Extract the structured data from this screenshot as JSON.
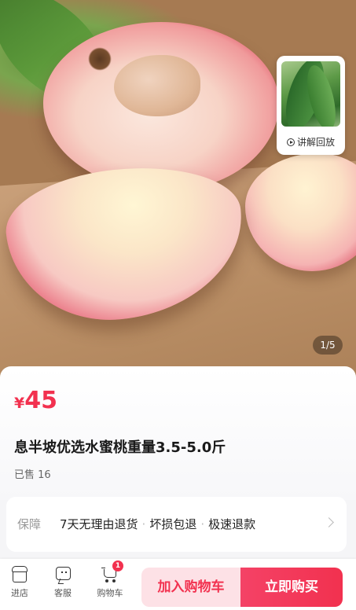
{
  "hero": {
    "video_label": "讲解回放",
    "pager": "1/5"
  },
  "product": {
    "price_symbol": "¥",
    "price": "45",
    "title": "息半坡优选水蜜桃重量3.5-5.0斤",
    "sold": "已售 16"
  },
  "guarantee": {
    "label": "保障",
    "items": [
      "7天无理由退货",
      "坏损包退",
      "极速退款"
    ],
    "separator": "·"
  },
  "bottom_bar": {
    "store_label": "进店",
    "service_label": "客服",
    "cart_label": "购物车",
    "cart_count": "1",
    "add_to_cart_label": "加入购物车",
    "buy_now_label": "立即购买"
  },
  "colors": {
    "accent": "#f2314f",
    "add_to_cart_bg": "#fde1e6"
  },
  "icons": [
    "play-circle-icon",
    "store-icon",
    "chat-icon",
    "cart-icon",
    "chevron-right-icon"
  ]
}
